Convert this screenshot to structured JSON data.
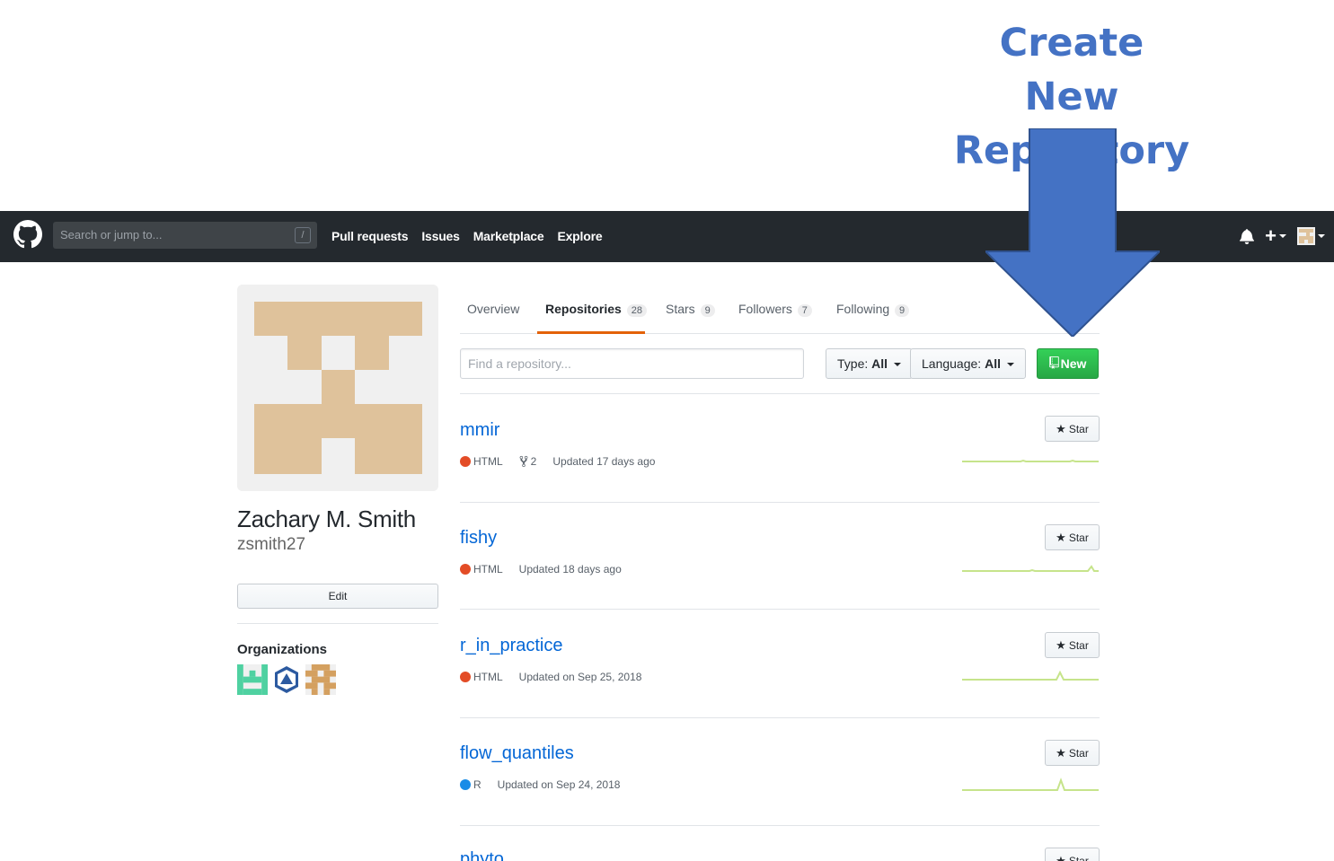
{
  "annotation": {
    "line1": "Create New",
    "line2": "Repository",
    "color": "#4472c4"
  },
  "header": {
    "search_placeholder": "Search or jump to...",
    "search_key": "/",
    "nav": [
      "Pull requests",
      "Issues",
      "Marketplace",
      "Explore"
    ],
    "plus_label": "+"
  },
  "profile": {
    "full_name": "Zachary M. Smith",
    "username": "zsmith27",
    "edit_label": "Edit",
    "orgs_heading": "Organizations"
  },
  "tabs": [
    {
      "label": "Overview",
      "count": ""
    },
    {
      "label": "Repositories",
      "count": "28"
    },
    {
      "label": "Stars",
      "count": "9"
    },
    {
      "label": "Followers",
      "count": "7"
    },
    {
      "label": "Following",
      "count": "9"
    }
  ],
  "filters": {
    "find_placeholder": "Find a repository...",
    "type_label": "Type:",
    "type_value": "All",
    "language_label": "Language:",
    "language_value": "All",
    "new_label": "New"
  },
  "star_label": "Star",
  "repos": [
    {
      "name": "mmir",
      "language": "HTML",
      "lang_color": "#e34c26",
      "forks": "2",
      "updated": "Updated 17 days ago"
    },
    {
      "name": "fishy",
      "language": "HTML",
      "lang_color": "#e34c26",
      "forks": "",
      "updated": "Updated 18 days ago"
    },
    {
      "name": "r_in_practice",
      "language": "HTML",
      "lang_color": "#e34c26",
      "forks": "",
      "updated": "Updated on Sep 25, 2018"
    },
    {
      "name": "flow_quantiles",
      "language": "R",
      "lang_color": "#198ce7",
      "forks": "",
      "updated": "Updated on Sep 24, 2018"
    },
    {
      "name": "phyto",
      "language": "",
      "lang_color": "",
      "forks": "",
      "updated": ""
    }
  ],
  "colors": {
    "header_bg": "#24292e",
    "link": "#0366d6",
    "new_button": "#28a745",
    "tab_accent": "#e36209"
  }
}
